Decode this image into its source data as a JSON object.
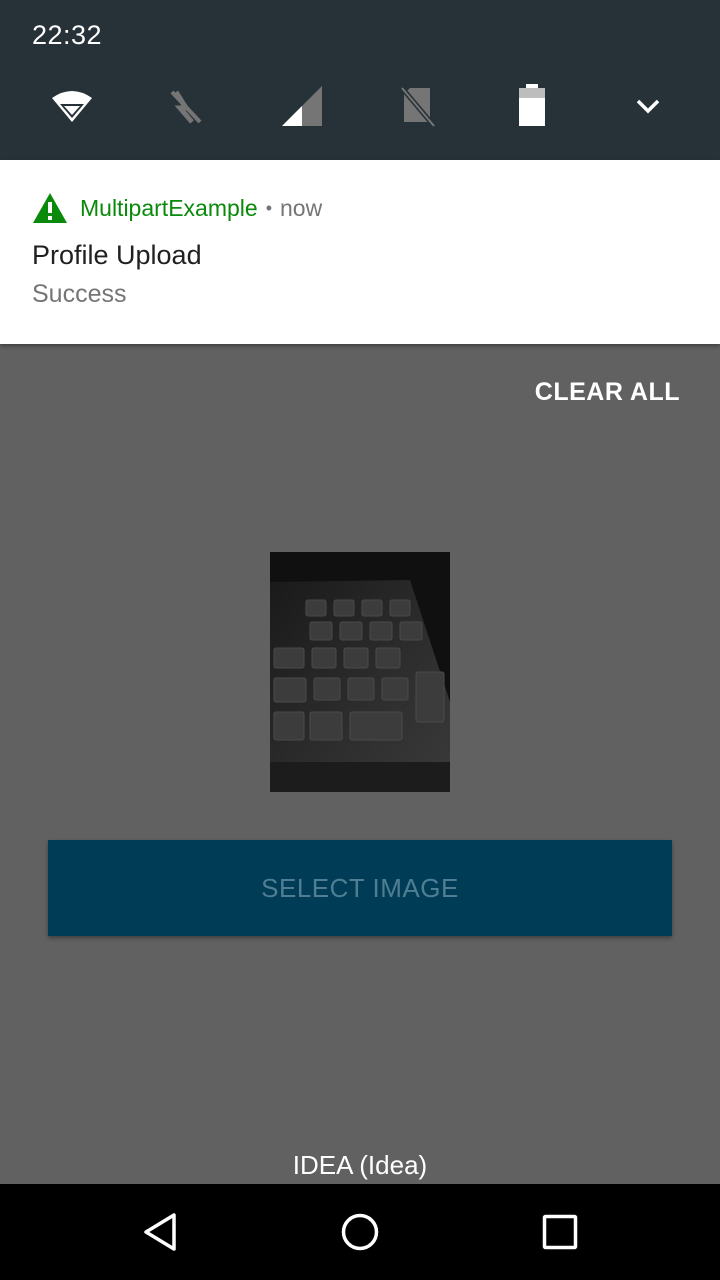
{
  "status_bar": {
    "time": "22:32",
    "tiles": [
      "wifi-icon",
      "data-off-icon",
      "cellular-signal-icon",
      "no-sim-icon",
      "battery-icon",
      "expand-chevron-icon"
    ]
  },
  "notification": {
    "app_icon": "warning-triangle-icon",
    "app_name": "MultipartExample",
    "separator": "•",
    "time": "now",
    "title": "Profile Upload",
    "text": "Success",
    "accent_color": "#0a8a0a"
  },
  "shade": {
    "clear_all": "CLEAR ALL"
  },
  "app": {
    "select_button": "SELECT IMAGE",
    "button_color": "#003c56",
    "carrier": "IDEA (Idea)"
  },
  "nav_bar": {
    "buttons": [
      "back-icon",
      "home-icon",
      "recents-icon"
    ]
  }
}
